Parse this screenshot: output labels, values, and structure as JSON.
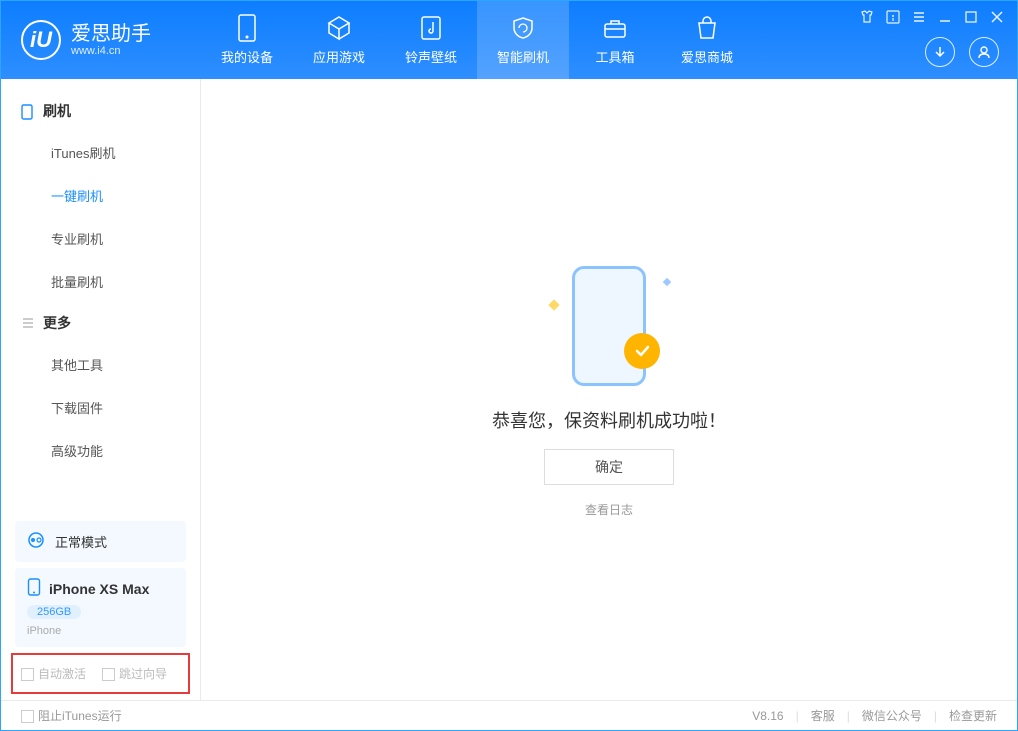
{
  "app": {
    "name": "爱思助手",
    "url": "www.i4.cn",
    "logo_letter": "iU"
  },
  "tabs": [
    {
      "label": "我的设备"
    },
    {
      "label": "应用游戏"
    },
    {
      "label": "铃声壁纸"
    },
    {
      "label": "智能刷机"
    },
    {
      "label": "工具箱"
    },
    {
      "label": "爱思商城"
    }
  ],
  "sidebar": {
    "group1": {
      "title": "刷机",
      "items": [
        "iTunes刷机",
        "一键刷机",
        "专业刷机",
        "批量刷机"
      ]
    },
    "group2": {
      "title": "更多",
      "items": [
        "其他工具",
        "下载固件",
        "高级功能"
      ]
    },
    "mode": "正常模式",
    "device": {
      "name": "iPhone XS Max",
      "storage": "256GB",
      "type": "iPhone"
    },
    "options": {
      "auto_activate": "自动激活",
      "skip_guide": "跳过向导"
    }
  },
  "main": {
    "message": "恭喜您，保资料刷机成功啦！",
    "ok": "确定",
    "view_log": "查看日志"
  },
  "footer": {
    "block_itunes": "阻止iTunes运行",
    "version": "V8.16",
    "links": [
      "客服",
      "微信公众号",
      "检查更新"
    ]
  }
}
